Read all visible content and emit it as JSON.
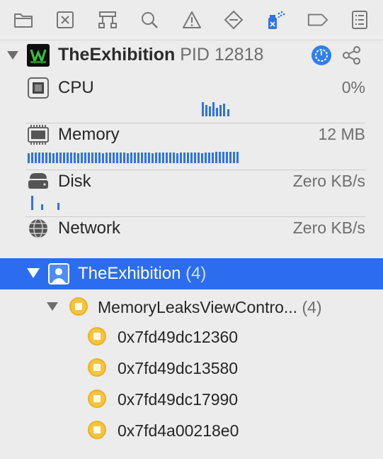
{
  "toolbar": {
    "icons": [
      "folder-icon",
      "close-box-icon",
      "hierarchy-icon",
      "search-icon",
      "warning-icon",
      "breakpoint-icon",
      "debug-spray-icon",
      "tag-icon",
      "list-icon"
    ],
    "accent": "#2e74e6"
  },
  "process": {
    "name": "TheExhibition",
    "pid_label": "PID 12818"
  },
  "gauges": [
    {
      "label": "CPU",
      "value": "0%"
    },
    {
      "label": "Memory",
      "value": "12 MB"
    },
    {
      "label": "Disk",
      "value": "Zero KB/s"
    },
    {
      "label": "Network",
      "value": "Zero KB/s"
    }
  ],
  "tree": {
    "root": {
      "label": "TheExhibition",
      "count": "(4)"
    },
    "class": {
      "label": "MemoryLeaksViewContro...",
      "count": "(4)"
    },
    "instances": [
      "0x7fd49dc12360",
      "0x7fd49dc13580",
      "0x7fd49dc17990",
      "0x7fd4a00218e0"
    ]
  },
  "colors": {
    "selection": "#2c6df0",
    "object_icon": "#f7c43d"
  }
}
